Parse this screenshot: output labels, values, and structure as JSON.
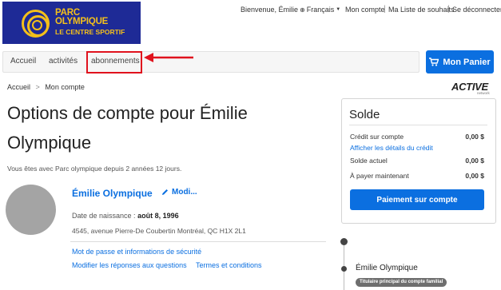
{
  "logo": {
    "line1": "PARC",
    "line2": "OLYMPIQUE",
    "line3": "LE CENTRE SPORTIF"
  },
  "topnav": {
    "welcome": "Bienvenue, Émilie",
    "language": "Français",
    "my_account": "Mon compte",
    "wishlist": "Ma Liste de souhaits",
    "logout": "Se déconnecter"
  },
  "nav": {
    "items": [
      "Accueil",
      "activités",
      "abonnements"
    ]
  },
  "cart": {
    "label": "Mon Panier"
  },
  "breadcrumb": {
    "home": "Accueil",
    "current": "Mon compte"
  },
  "brand": {
    "name": "ACTIVE",
    "sub": "network"
  },
  "page": {
    "title": "Options de compte pour Émilie Olympique",
    "member_since": "Vous êtes avec Parc olympique depuis 2 années 12 jours."
  },
  "profile": {
    "name": "Émilie Olympique",
    "edit_label": "Modi...",
    "dob_label": "Date de naissance :",
    "dob_value": "août 8, 1996",
    "address": "4545, avenue Pierre-De Coubertin Montréal, QC H1X 2L1",
    "link_password": "Mot de passe et informations de sécurité",
    "link_answers": "Modifier les réponses aux questions",
    "link_terms": "Termes et conditions"
  },
  "balance": {
    "title": "Solde",
    "credit_label": "Crédit sur compte",
    "credit_value": "0,00 $",
    "credit_details_link": "Afficher les détails du crédit",
    "current_label": "Solde actuel",
    "current_value": "0,00 $",
    "due_label": "À payer maintenant",
    "due_value": "0,00 $",
    "pay_button": "Paiement sur compte"
  },
  "family": {
    "member_name": "Émilie Olympique",
    "member_badge": "Titulaire principal du compte familial"
  },
  "colors": {
    "accent": "#0b6fe0",
    "logo_bg": "#1e2a96",
    "logo_fg": "#f4c01a",
    "annotation": "#e0121d"
  }
}
